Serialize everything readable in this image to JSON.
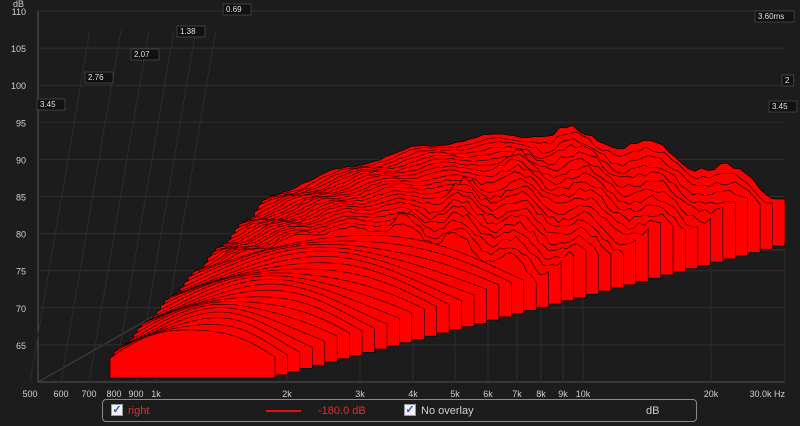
{
  "chart_data": {
    "type": "area",
    "subtype": "waterfall-3d",
    "ylabel": "dB",
    "ylim": [
      60,
      110
    ],
    "y_ticks": [
      65,
      70,
      75,
      80,
      85,
      90,
      95,
      100,
      105,
      110
    ],
    "x_scale": "log",
    "x_ticks": [
      "500",
      "600",
      "700",
      "800",
      "900",
      "1k",
      "2k",
      "3k",
      "4k",
      "5k",
      "6k",
      "7k",
      "8k",
      "9k",
      "10k",
      "20k",
      "30.0k Hz"
    ],
    "time_labels": [
      "3.45",
      "2.76",
      "2.07",
      "1.38",
      "0.69",
      "3.60ms",
      "3.45",
      "2"
    ],
    "grid": true,
    "fill_color": "#ff0000",
    "outline_color": "#000000",
    "series": [
      {
        "name": "right",
        "x": [
          1000,
          2000,
          4000,
          8000,
          10000,
          20000,
          30000
        ],
        "values": [
          62,
          67,
          72,
          75,
          77,
          78,
          79
        ]
      }
    ]
  },
  "legend": {
    "series_checkbox_label": "right",
    "level": "-180.0 dB",
    "overlay_label": "No overlay",
    "unit": "dB"
  }
}
